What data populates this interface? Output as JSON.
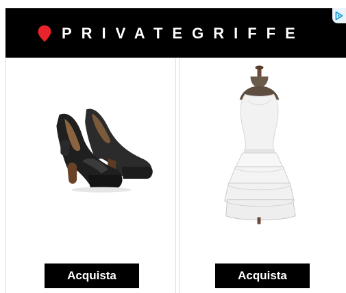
{
  "header": {
    "brand": "PRIVATEGRIFFE",
    "pin_icon": "map-pin-icon",
    "adchoices_icon": "adchoices-icon"
  },
  "products": [
    {
      "image": "black-platform-heels",
      "button_label": "Acquista"
    },
    {
      "image": "white-ruffle-dress",
      "button_label": "Acquista"
    }
  ],
  "colors": {
    "header_bg": "#000000",
    "brand_text": "#ffffff",
    "pin": "#e8232a",
    "button_bg": "#000000",
    "button_text": "#ffffff",
    "adchoices": "#1e9bd7"
  }
}
